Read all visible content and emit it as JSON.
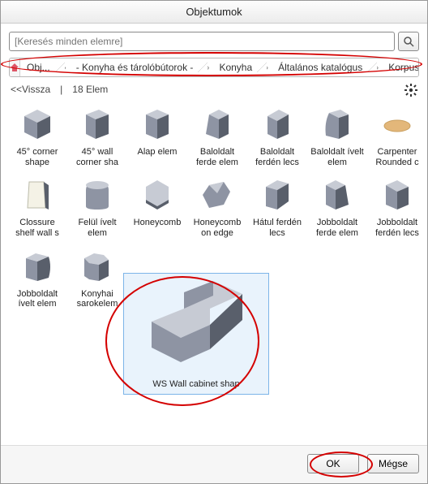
{
  "window": {
    "title": "Objektumok"
  },
  "search": {
    "placeholder": "[Keresés minden elemre]"
  },
  "breadcrumb": {
    "segments": [
      "Obj...",
      "- Konyha és tárolóbútorok -",
      "Konyha",
      "Általános katalógus",
      "Korpusz formák"
    ]
  },
  "meta": {
    "back": "<<Vissza",
    "count_label": "18 Elem"
  },
  "items": [
    {
      "label": "45° corner shape"
    },
    {
      "label": "45° wall corner sha"
    },
    {
      "label": "Alap elem"
    },
    {
      "label": "Baloldalt ferde elem"
    },
    {
      "label": "Baloldalt ferdén lecs"
    },
    {
      "label": "Baloldalt ívelt elem"
    },
    {
      "label": "Carpenter Rounded c"
    },
    {
      "label": "Clossure shelf wall s"
    },
    {
      "label": "Felül ívelt elem"
    },
    {
      "label": "Honeycomb"
    },
    {
      "label": "Honeycomb on edge"
    },
    {
      "label": "Hátul ferdén lecs"
    },
    {
      "label": "Jobboldalt ferde elem"
    },
    {
      "label": "Jobboldalt ferdén lecs"
    },
    {
      "label": "Jobboldalt ívelt elem"
    },
    {
      "label": "Konyhai sarokelem"
    },
    {
      "label": "WS Wall cabinet shap",
      "selected": true
    }
  ],
  "selection_caption": "WS Wall cabinet shap",
  "buttons": {
    "ok": "OK",
    "cancel": "Mégse"
  },
  "colors": {
    "annotation": "#d40000",
    "selection_bg": "#e9f3fc",
    "selection_border": "#7cb4e8"
  }
}
